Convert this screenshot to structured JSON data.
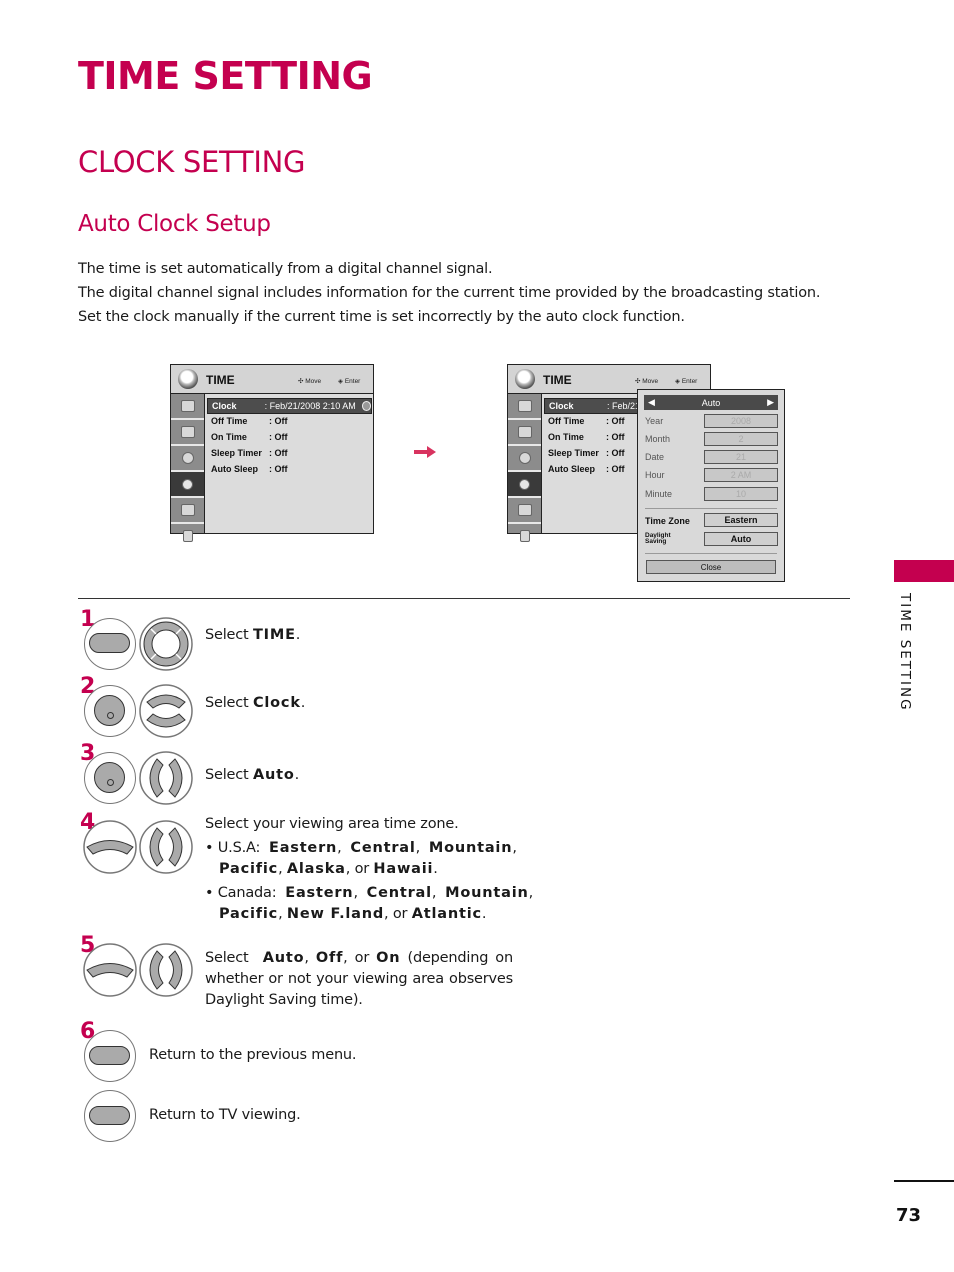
{
  "page": {
    "title": "TIME SETTING",
    "section": "CLOCK SETTING",
    "subsection": "Auto Clock Setup",
    "intro": [
      "The time is set automatically from a digital channel signal.",
      "The digital channel signal includes information for the current time provided by the broadcasting station.",
      "Set the clock manually if the current time is set incorrectly by the auto clock function."
    ],
    "side_tab_label": "TIME SETTING",
    "page_number": "73",
    "brand_color": "#c4004f"
  },
  "osd_left": {
    "title": "TIME",
    "hint_move": "Move",
    "hint_enter": "Enter",
    "rows": [
      {
        "label": "Clock",
        "value": ": Feb/21/2008  2:10 AM"
      },
      {
        "label": "Off Time",
        "value": ": Off"
      },
      {
        "label": "On Time",
        "value": ": Off"
      },
      {
        "label": "Sleep Timer",
        "value": ": Off"
      },
      {
        "label": "Auto Sleep",
        "value": ": Off"
      }
    ],
    "sidebar_icons": [
      "picture-icon",
      "screen-icon",
      "audio-icon",
      "time-icon",
      "option-icon",
      "lock-icon"
    ]
  },
  "osd_right": {
    "title": "TIME",
    "hint_move": "Move",
    "hint_enter": "Enter",
    "rows": [
      {
        "label": "Clock",
        "value": ": Feb/21/"
      },
      {
        "label": "Off Time",
        "value": ": Off"
      },
      {
        "label": "On Time",
        "value": ": Off"
      },
      {
        "label": "Sleep Timer",
        "value": ": Off"
      },
      {
        "label": "Auto Sleep",
        "value": ": Off"
      }
    ],
    "popup": {
      "mode": "Auto",
      "fields": [
        {
          "label": "Year",
          "value": "2008"
        },
        {
          "label": "Month",
          "value": "2"
        },
        {
          "label": "Date",
          "value": "21"
        },
        {
          "label": "Hour",
          "value": "2 AM"
        },
        {
          "label": "Minute",
          "value": "10"
        }
      ],
      "time_zone_label": "Time Zone",
      "time_zone_value": "Eastern",
      "daylight_label_1": "Daylight",
      "daylight_label_2": "Saving",
      "daylight_value": "Auto",
      "close_label": "Close"
    }
  },
  "steps": [
    {
      "num": "1",
      "pre": "Select ",
      "bold": "TIME",
      "post": "."
    },
    {
      "num": "2",
      "pre": "Select ",
      "bold": "Clock",
      "post": "."
    },
    {
      "num": "3",
      "pre": "Select ",
      "bold": "Auto",
      "post": "."
    },
    {
      "num": "4",
      "intro": "Select your viewing area time zone.",
      "usa_label": "• U.S.A:",
      "usa": [
        "Eastern",
        "Central",
        "Mountain",
        "Pacific",
        "Alaska",
        "Hawaii"
      ],
      "canada_label": "• Canada:",
      "canada": [
        "Eastern",
        "Central",
        "Mountain",
        "Pacific",
        "New F.land",
        "Atlantic"
      ],
      "or": "or"
    },
    {
      "num": "5",
      "pre": "Select",
      "opts": [
        "Auto",
        "Off",
        "On"
      ],
      "or": "or",
      "post": "(depending on whether or not your viewing area observes Daylight Saving time)."
    },
    {
      "num": "6",
      "text_a": "Return to the previous menu.",
      "text_b": "Return to TV viewing."
    }
  ]
}
